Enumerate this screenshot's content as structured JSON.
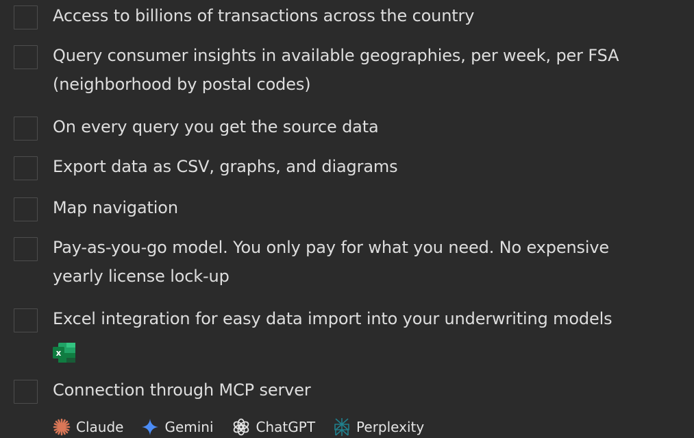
{
  "checklist": {
    "items": [
      {
        "lines": [
          "Access to billions of transactions across the country"
        ]
      },
      {
        "lines": [
          "Query consumer insights in available geographies, per week, per FSA",
          "(neighborhood by postal codes)"
        ]
      },
      {
        "lines": [
          "On every query you get the source data"
        ]
      },
      {
        "lines": [
          "Export data as CSV, graphs, and diagrams"
        ]
      },
      {
        "lines": [
          "Map navigation"
        ]
      },
      {
        "lines": [
          "Pay-as-you-go model. You only pay for what you need. No expensive",
          "yearly license lock-up"
        ]
      },
      {
        "lines": [
          "Excel integration for easy data import into your underwriting models"
        ]
      },
      {
        "lines": [
          "Connection through MCP server"
        ]
      }
    ]
  },
  "excel_icon": {
    "letter": "x",
    "color": "#1f8a4c"
  },
  "integrations": [
    {
      "name": "Claude",
      "icon": "claude-icon",
      "color": "#d97757"
    },
    {
      "name": "Gemini",
      "icon": "gemini-icon",
      "color": "#4c8df6"
    },
    {
      "name": "ChatGPT",
      "icon": "chatgpt-icon",
      "color": "#e4e4e4"
    },
    {
      "name": "Perplexity",
      "icon": "perplexity-icon",
      "color": "#20808d"
    }
  ]
}
